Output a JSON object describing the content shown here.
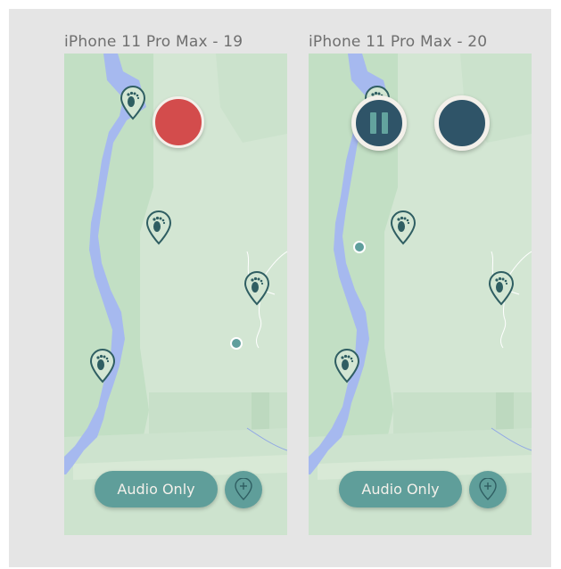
{
  "artboards": [
    {
      "title": "iPhone 11 Pro Max - 19",
      "state": "idle",
      "record_button_color": "#d34c4c",
      "audio_button_label": "Audio Only",
      "add_pin_icon": "add-location-icon",
      "pin_icon": "footprint-pin-icon"
    },
    {
      "title": "iPhone 11 Pro Max - 20",
      "state": "recording",
      "pause_icon": "pause-icon",
      "stop_button_color": "#2f5468",
      "audio_button_label": "Audio Only",
      "add_pin_icon": "add-location-icon",
      "pin_icon": "footprint-pin-icon"
    }
  ],
  "colors": {
    "canvas": "#e5e5e5",
    "map_land": "#d3e6d3",
    "map_forest": "#bfdcc0",
    "water": "#a6b9ef",
    "accent": "#5f9e9a",
    "pin_stroke": "#2f5e62"
  }
}
